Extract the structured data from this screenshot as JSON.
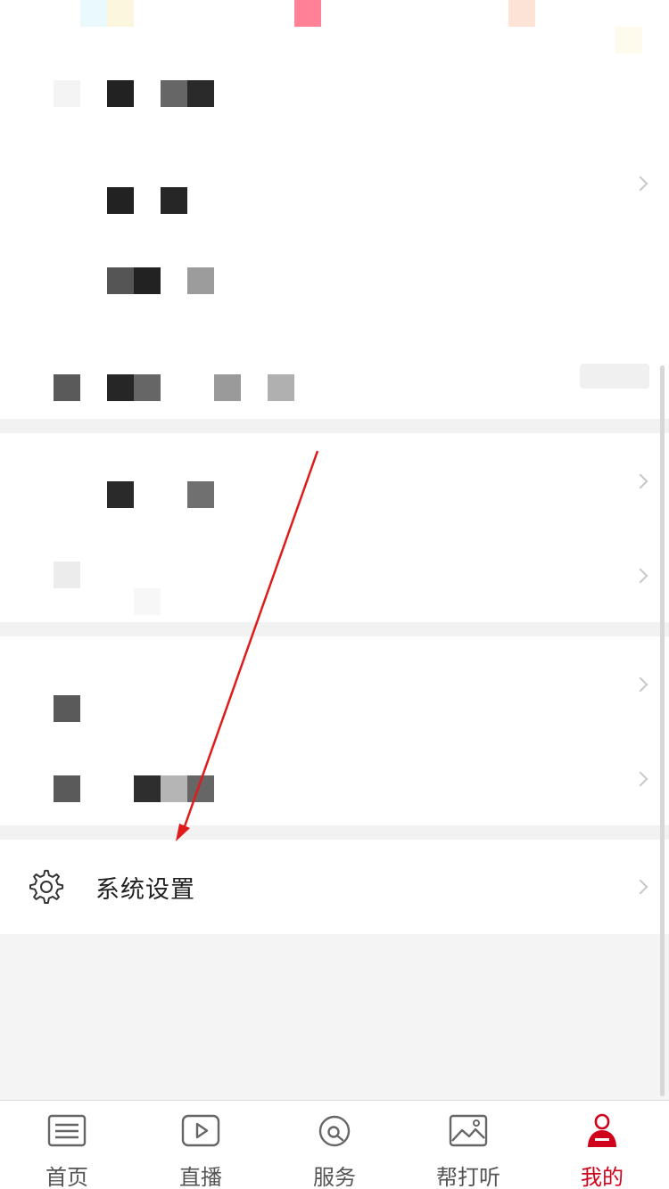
{
  "settings": {
    "label": "系统设置"
  },
  "tabs": [
    {
      "label": "首页",
      "icon": "news-icon"
    },
    {
      "label": "直播",
      "icon": "play-icon"
    },
    {
      "label": "服务",
      "icon": "service-icon"
    },
    {
      "label": "帮打听",
      "icon": "image-icon"
    },
    {
      "label": "我的",
      "icon": "profile-icon",
      "active": true
    }
  ],
  "colors": {
    "accent": "#d0021b",
    "arrow": "#e01b1b"
  }
}
